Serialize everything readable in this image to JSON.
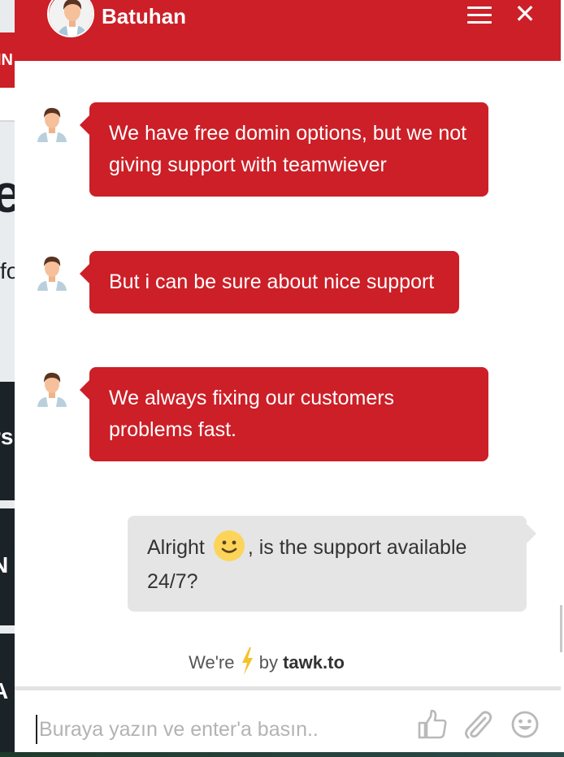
{
  "background_page": {
    "red_tab_text": "IN",
    "heading_fragment": "e",
    "paragraph_fragment": "fo",
    "dark_panels": [
      "rs",
      "N",
      "A"
    ]
  },
  "chat": {
    "header": {
      "agent_name": "Batuhan",
      "menu_icon": "hamburger-menu-icon",
      "close_icon": "close-icon",
      "close_glyph": "✕"
    },
    "colors": {
      "brand": "#cc1f27",
      "agent_bubble_text": "#ffffff",
      "visitor_bubble": "#e5e5e5",
      "visitor_text": "#333333",
      "placeholder": "#b3b3b3"
    },
    "messages": [
      {
        "sender": "agent",
        "text": "We have free domin options, but we not giving support with teamwiever"
      },
      {
        "sender": "agent",
        "text": "But i can be sure about nice support"
      },
      {
        "sender": "agent",
        "text": "We always fixing our customers problems fast."
      },
      {
        "sender": "visitor",
        "text_before_emoji": "Alright ",
        "emoji": "slightly-smiling-face",
        "text_after_emoji": ", is the support available 24/7?"
      }
    ],
    "powered_by": {
      "prefix": "We're",
      "icon": "lightning-bolt-icon",
      "middle": "by",
      "brand": "tawk.to"
    },
    "composer": {
      "placeholder": "Buraya yazın ve enter'a basın..",
      "value": "",
      "icons": [
        "thumbs-up-icon",
        "paperclip-icon",
        "emoji-smile-icon"
      ]
    }
  }
}
